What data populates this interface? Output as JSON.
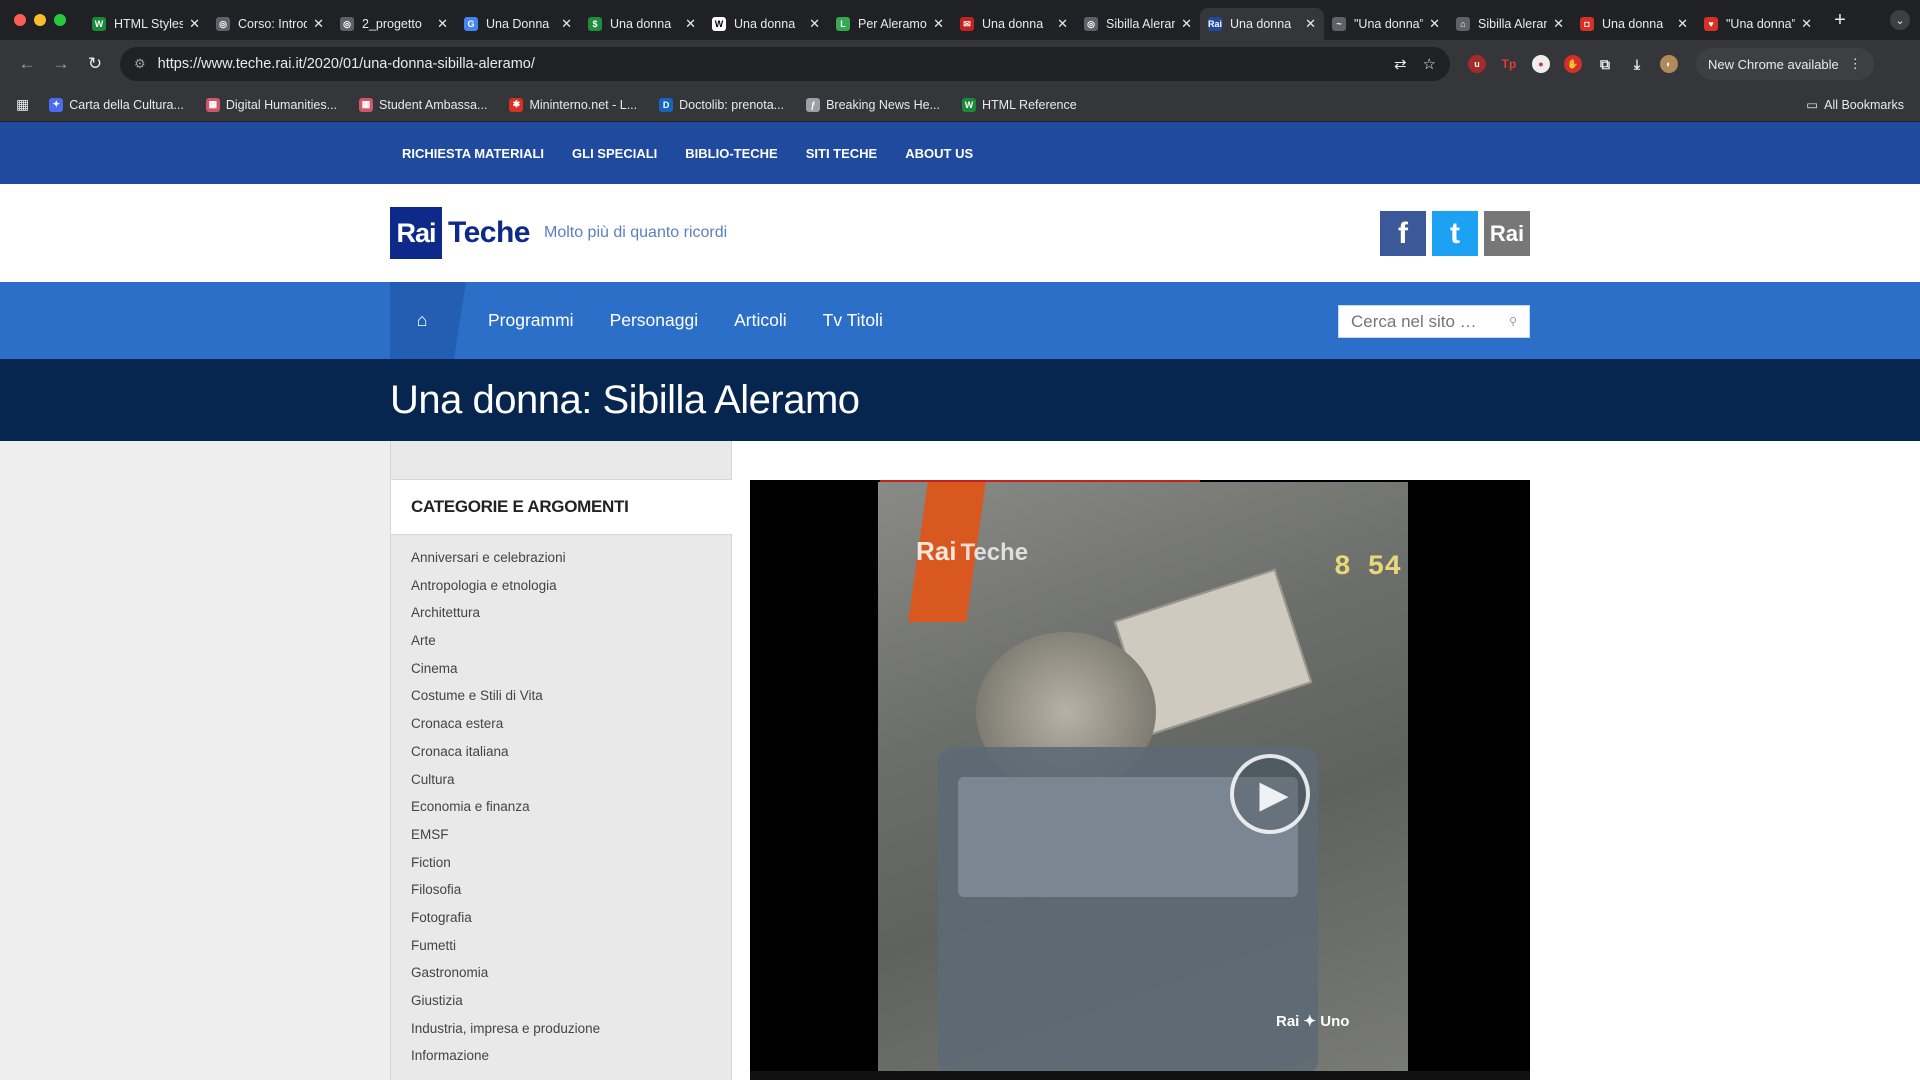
{
  "browser": {
    "tabs": [
      {
        "title": "HTML Styles",
        "fav_color": "#1b8a3a",
        "fav_glyph": "W",
        "active": false
      },
      {
        "title": "Corso: Introduzione",
        "fav_color": "#5f6368",
        "fav_glyph": "◎",
        "active": false
      },
      {
        "title": "2_progetto",
        "fav_color": "#5f6368",
        "fav_glyph": "◎",
        "active": false
      },
      {
        "title": "Una Donna",
        "fav_color": "#4285f4",
        "fav_glyph": "G",
        "active": false
      },
      {
        "title": "Una donna",
        "fav_color": "#1e8e3e",
        "fav_glyph": "$",
        "active": false
      },
      {
        "title": "Una donna",
        "fav_color": "#ffffff",
        "fav_glyph": "W",
        "active": false
      },
      {
        "title": "Per Aleramo",
        "fav_color": "#34a853",
        "fav_glyph": "L",
        "active": false
      },
      {
        "title": "Una donna",
        "fav_color": "#c5221f",
        "fav_glyph": "✉",
        "active": false
      },
      {
        "title": "Sibilla Aleramo",
        "fav_color": "#5f6368",
        "fav_glyph": "◎",
        "active": false
      },
      {
        "title": "Una donna",
        "fav_color": "#1f4a9e",
        "fav_glyph": "Rai",
        "active": true
      },
      {
        "title": "\"Una donna\"",
        "fav_color": "#5f6368",
        "fav_glyph": "~",
        "active": false
      },
      {
        "title": "Sibilla Aleramo",
        "fav_color": "#5f6368",
        "fav_glyph": "⌂",
        "active": false
      },
      {
        "title": "Una donna",
        "fav_color": "#d93025",
        "fav_glyph": "◘",
        "active": false
      },
      {
        "title": "\"Una donna\"",
        "fav_color": "#d93025",
        "fav_glyph": "♥",
        "active": false
      }
    ],
    "url": "https://www.teche.rai.it/2020/01/una-donna-sibilla-aleramo/",
    "new_chrome": "New Chrome available",
    "bookmarks": [
      {
        "label": "Carta della Cultura...",
        "color": "#4a6cf0",
        "glyph": "✦"
      },
      {
        "label": "Digital Humanities...",
        "color": "#d0576b",
        "glyph": "▦"
      },
      {
        "label": "Student Ambassa...",
        "color": "#d0576b",
        "glyph": "▦"
      },
      {
        "label": "Mininterno.net - L...",
        "color": "#d93025",
        "glyph": "✱"
      },
      {
        "label": "Doctolib: prenota...",
        "color": "#1565c0",
        "glyph": "D"
      },
      {
        "label": "Breaking News He...",
        "color": "#9aa0a6",
        "glyph": "ƒ"
      },
      {
        "label": "HTML Reference",
        "color": "#1b8a3a",
        "glyph": "W"
      }
    ],
    "all_bookmarks": "All Bookmarks"
  },
  "site": {
    "topnav": [
      "RICHIESTA MATERIALI",
      "GLI SPECIALI",
      "BIBLIO-TECHE",
      "SITI TECHE",
      "ABOUT US"
    ],
    "logo_rai": "Rai",
    "logo_teche": "Teche",
    "tagline": "Molto più di quanto ricordi",
    "social": [
      {
        "label": "f",
        "color": "#3b5998"
      },
      {
        "label": "t",
        "color": "#1da1f2"
      },
      {
        "label": "Rai",
        "color": "#777777"
      }
    ],
    "menu": [
      "Programmi",
      "Personaggi",
      "Articoli",
      "Tv Titoli"
    ],
    "search_placeholder": "Cerca nel sito …",
    "page_title": "Una donna: Sibilla Aleramo"
  },
  "sidebar": {
    "heading": "CATEGORIE E ARGOMENTI",
    "categories": [
      "Anniversari e celebrazioni",
      "Antropologia e etnologia",
      "Architettura",
      "Arte",
      "Cinema",
      "Costume e Stili di Vita",
      "Cronaca estera",
      "Cronaca italiana",
      "Cultura",
      "Economia e finanza",
      "EMSF",
      "Fiction",
      "Filosofia",
      "Fotografia",
      "Fumetti",
      "Gastronomia",
      "Giustizia",
      "Industria, impresa e produzione",
      "Informazione"
    ]
  },
  "video": {
    "watermark_rai": "Rai",
    "watermark_teche": "Teche",
    "clock": "8 54",
    "channel_logo": "Rai ✦ Uno"
  }
}
